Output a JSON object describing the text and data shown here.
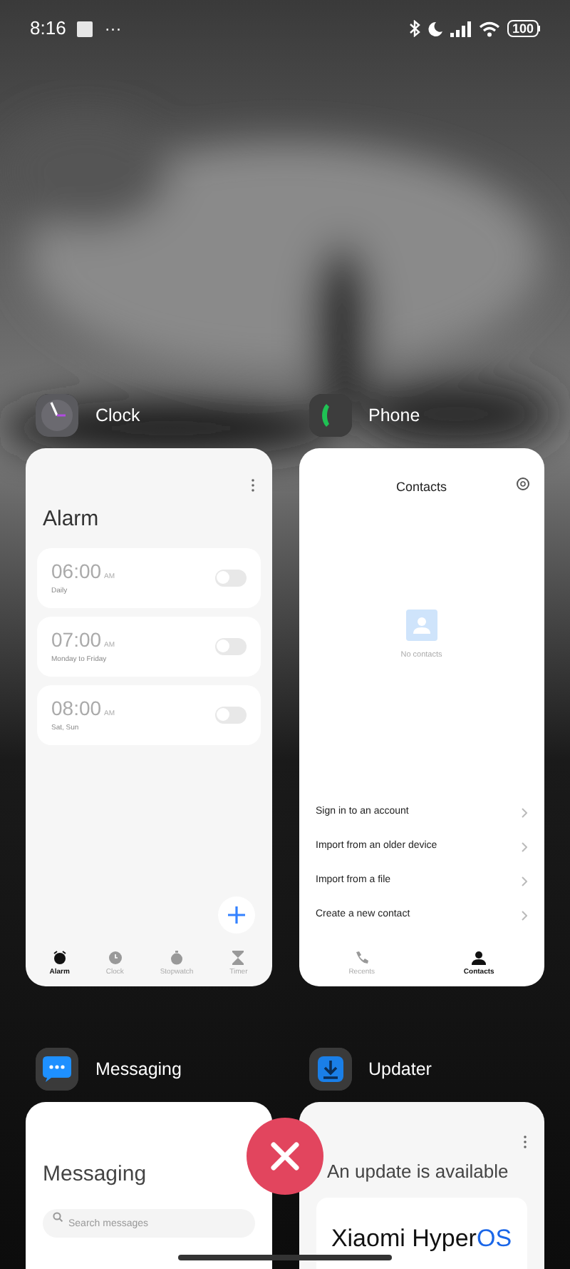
{
  "status_bar": {
    "time": "8:16",
    "overflow": "···",
    "battery": "100"
  },
  "apps": [
    {
      "name": "Clock",
      "kind": "clock",
      "screen": {
        "title": "Alarm",
        "alarms": [
          {
            "time": "06:00",
            "period": "AM",
            "label": "Daily",
            "on": false
          },
          {
            "time": "07:00",
            "period": "AM",
            "label": "Monday to Friday",
            "on": false
          },
          {
            "time": "08:00",
            "period": "AM",
            "label": "Sat, Sun",
            "on": false
          }
        ],
        "tabs": [
          {
            "label": "Alarm",
            "selected": true
          },
          {
            "label": "Clock",
            "selected": false
          },
          {
            "label": "Stopwatch",
            "selected": false
          },
          {
            "label": "Timer",
            "selected": false
          }
        ]
      }
    },
    {
      "name": "Phone",
      "kind": "phone",
      "screen": {
        "title": "Contacts",
        "empty_text": "No contacts",
        "actions": [
          "Sign in to an account",
          "Import from an older device",
          "Import from a file",
          "Create a new contact"
        ],
        "tabs": [
          {
            "label": "Recents",
            "selected": false
          },
          {
            "label": "Contacts",
            "selected": true
          }
        ]
      }
    },
    {
      "name": "Messaging",
      "kind": "messaging",
      "screen": {
        "title": "Messaging",
        "search": {
          "placeholder": "Search messages"
        }
      }
    },
    {
      "name": "Updater",
      "kind": "updater",
      "screen": {
        "title": "An update is available",
        "brand": "Xiaomi Hyper",
        "brand_accent": "OS"
      }
    }
  ]
}
